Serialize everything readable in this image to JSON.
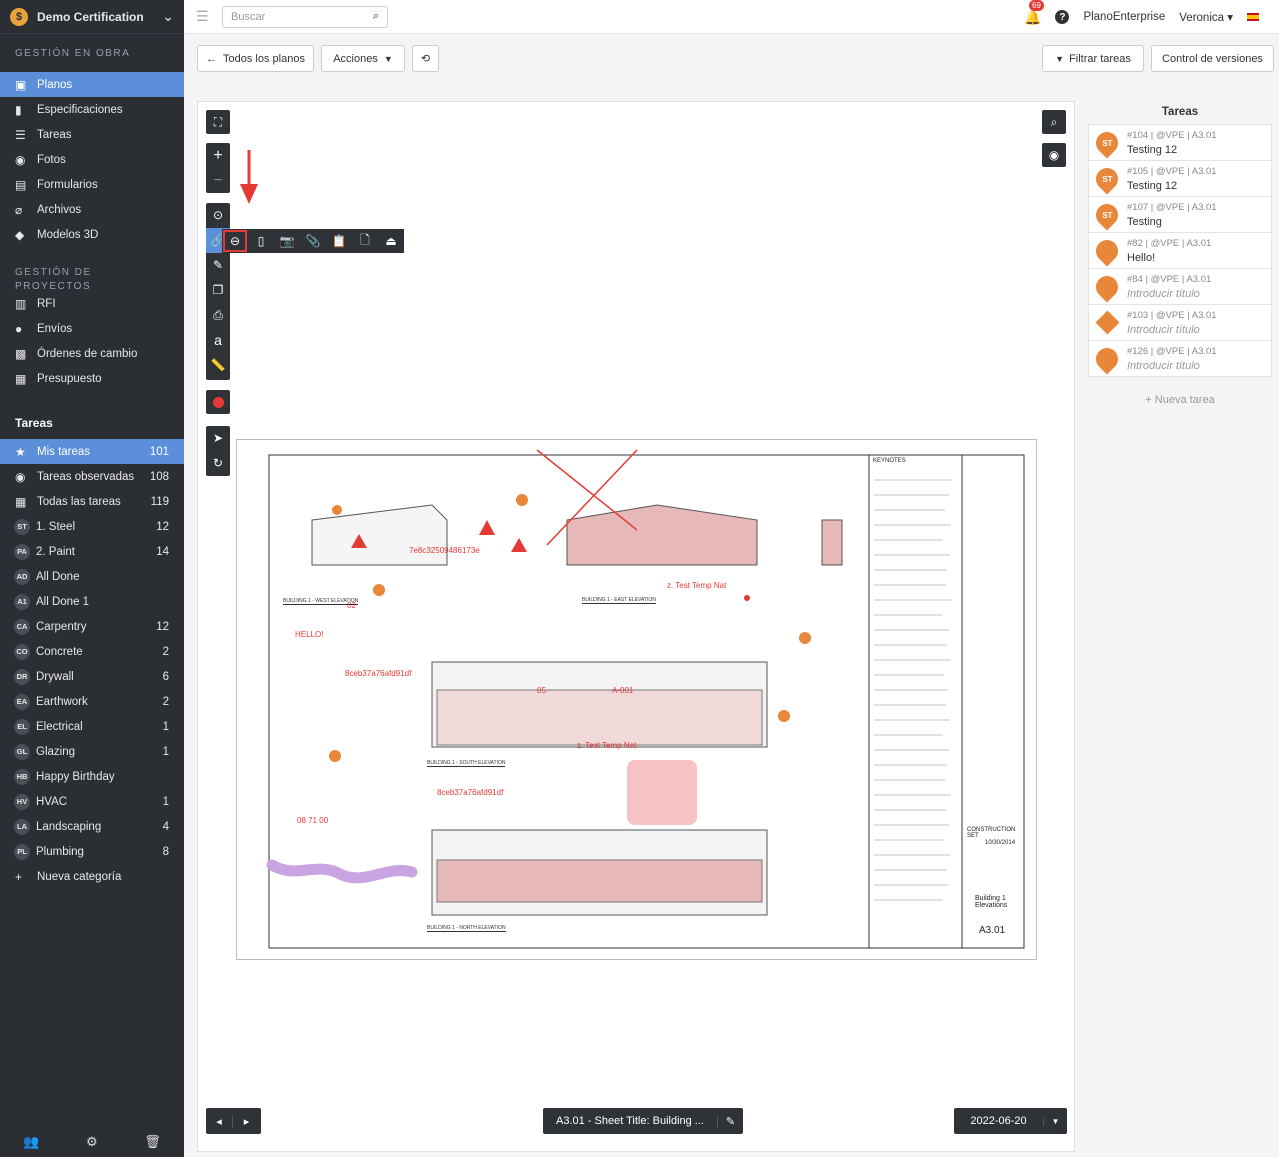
{
  "brand": {
    "name": "Demo Certification"
  },
  "sidebar": {
    "section_obra": "GESTIÓN EN OBRA",
    "obra_items": [
      {
        "label": "Planos",
        "icon": "plans-icon"
      },
      {
        "label": "Especificaciones",
        "icon": "book-icon"
      },
      {
        "label": "Tareas",
        "icon": "list-icon"
      },
      {
        "label": "Fotos",
        "icon": "camera-icon"
      },
      {
        "label": "Formularios",
        "icon": "clipboard-icon"
      },
      {
        "label": "Archivos",
        "icon": "paperclip-icon"
      },
      {
        "label": "Modelos 3D",
        "icon": "cube-icon"
      }
    ],
    "section_proyectos": "GESTIÓN DE PROYECTOS",
    "proyectos_items": [
      {
        "label": "RFI",
        "icon": "rfi-icon"
      },
      {
        "label": "Envíos",
        "icon": "user-icon"
      },
      {
        "label": "Órdenes de cambio",
        "icon": "change-order-icon"
      },
      {
        "label": "Presupuesto",
        "icon": "calculator-icon"
      }
    ],
    "tareas_title": "Tareas",
    "task_filters": [
      {
        "label": "Mis tareas",
        "count": "101",
        "icon": "star-icon"
      },
      {
        "label": "Tareas observadas",
        "count": "108",
        "icon": "eye-icon"
      },
      {
        "label": "Todas las tareas",
        "count": "119",
        "icon": "grid-icon"
      }
    ],
    "categories": [
      {
        "badge": "ST",
        "label": "1. Steel",
        "count": "12"
      },
      {
        "badge": "PA",
        "label": "2. Paint",
        "count": "14"
      },
      {
        "badge": "AD",
        "label": "All Done",
        "count": ""
      },
      {
        "badge": "A1",
        "label": "All Done 1",
        "count": ""
      },
      {
        "badge": "CA",
        "label": "Carpentry",
        "count": "12"
      },
      {
        "badge": "CO",
        "label": "Concrete",
        "count": "2"
      },
      {
        "badge": "DR",
        "label": "Drywall",
        "count": "6"
      },
      {
        "badge": "EA",
        "label": "Earthwork",
        "count": "2"
      },
      {
        "badge": "EL",
        "label": "Electrical",
        "count": "1"
      },
      {
        "badge": "GL",
        "label": "Glazing",
        "count": "1"
      },
      {
        "badge": "HB",
        "label": "Happy Birthday",
        "count": ""
      },
      {
        "badge": "HV",
        "label": "HVAC",
        "count": "1"
      },
      {
        "badge": "LA",
        "label": "Landscaping",
        "count": "4"
      },
      {
        "badge": "PL",
        "label": "Plumbing",
        "count": "8"
      }
    ],
    "new_category": "Nueva categoría"
  },
  "topbar": {
    "search_placeholder": "Buscar",
    "notifications": "69",
    "org": "PlanoEnterprise",
    "user": "Veronica"
  },
  "toolbar": {
    "all_plans": "Todos los planos",
    "actions": "Acciones",
    "filter_tasks": "Filtrar tareas",
    "version_control": "Control de versiones"
  },
  "tasks_panel": {
    "title": "Tareas",
    "items": [
      {
        "meta": "#104 | @VPE | A3.01",
        "title": "Testing 12",
        "badge": "ST",
        "shape": "pin",
        "placeholder": false
      },
      {
        "meta": "#105 | @VPE | A3.01",
        "title": "Testing 12",
        "badge": "ST",
        "shape": "pin",
        "placeholder": false
      },
      {
        "meta": "#107 | @VPE | A3.01",
        "title": "Testing",
        "badge": "ST",
        "shape": "pin",
        "placeholder": false
      },
      {
        "meta": "#82 | @VPE | A3.01",
        "title": "Hello!",
        "badge": "",
        "shape": "pin",
        "placeholder": false
      },
      {
        "meta": "#84 | @VPE | A3.01",
        "title": "Introducir título",
        "badge": "",
        "shape": "pin",
        "placeholder": true
      },
      {
        "meta": "#103 | @VPE | A3.01",
        "title": "Introducir título",
        "badge": "",
        "shape": "diamond",
        "placeholder": true
      },
      {
        "meta": "#126 | @VPE | A3.01",
        "title": "Introducir título",
        "badge": "",
        "shape": "pin",
        "placeholder": true
      }
    ],
    "new_task": "+ Nueva tarea"
  },
  "bottom": {
    "sheet": "A3.01 - Sheet Title: Building ...",
    "date": "2022-06-20"
  },
  "drawing": {
    "labels": [
      "7e8c32509486173e",
      "z. Test Temp Nat",
      "HELLO!",
      "8ceb37a76afd91df",
      "05",
      "A-001",
      "z. Test Temp Nat",
      "8ceb37a76afd91df",
      "08 71 00",
      "02"
    ],
    "elevations": [
      "BUILDING 1 - WEST ELEVATION",
      "BUILDING 1 - EAST ELEVATION",
      "BUILDING 1 - SOUTH ELEVATION",
      "BUILDING 1 - NORTH ELEVATION"
    ],
    "keynotes": "KEYNOTES",
    "construction_set": "CONSTRUCTION SET",
    "set_date": "10/30/2014",
    "sheet_title": "Building 1 Elevations",
    "sheet_number": "A3.01"
  }
}
